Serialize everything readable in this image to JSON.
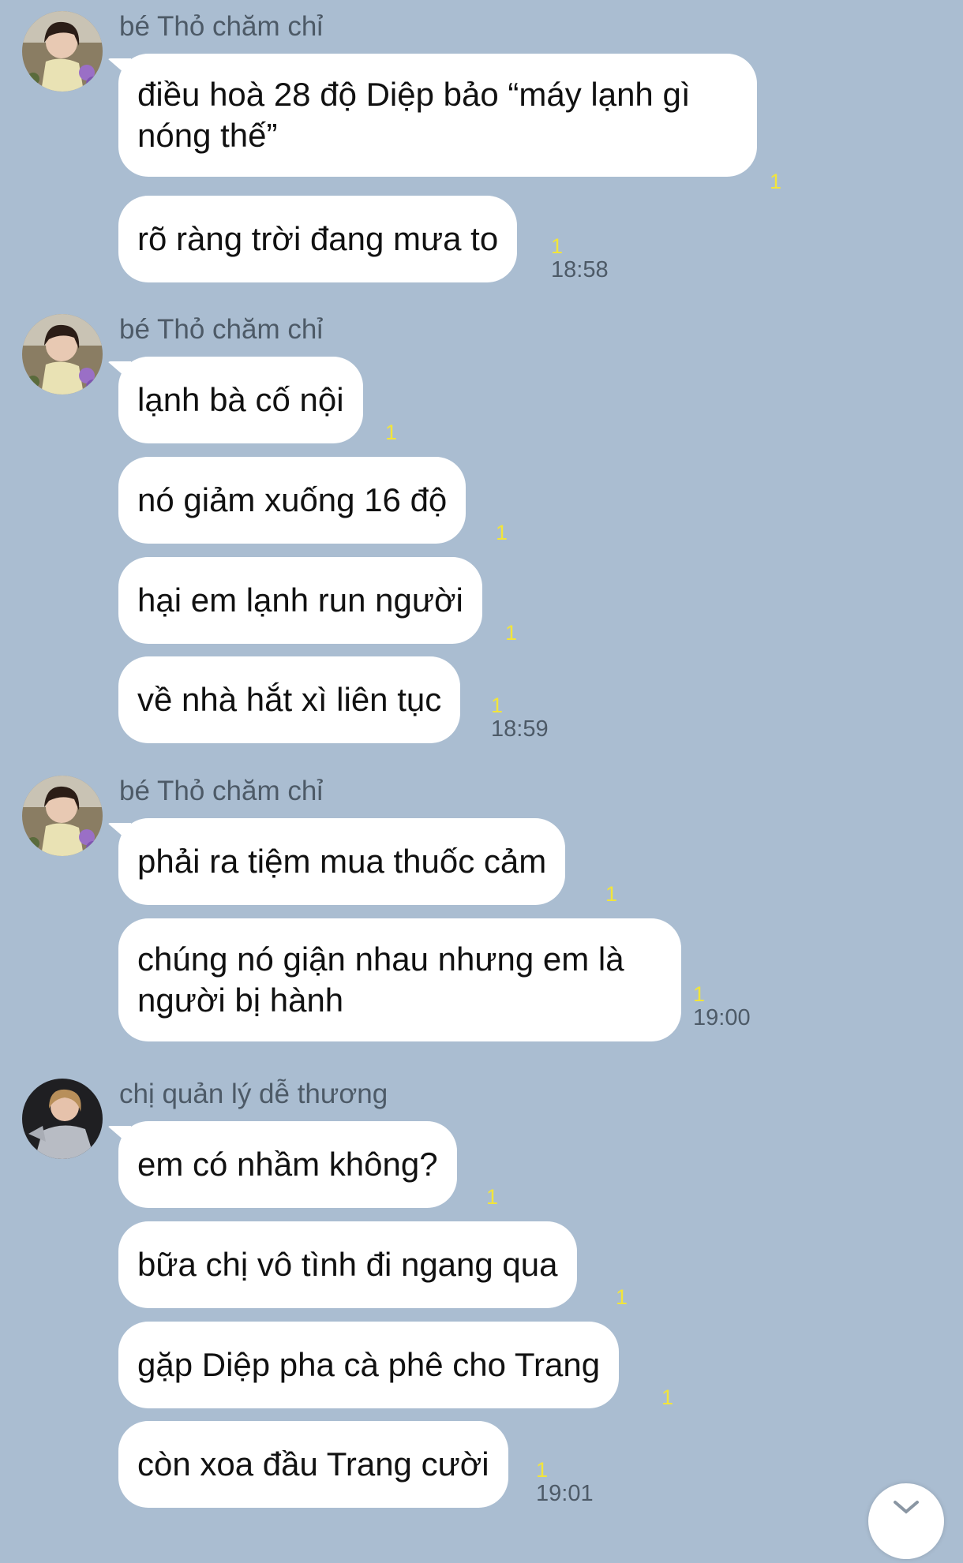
{
  "groups": [
    {
      "sender": "bé Thỏ chăm chỉ",
      "avatar": "avatar-girl-flowers",
      "messages": [
        {
          "text": "điều hoà 28 độ Diệp bảo “máy lạnh gì nóng thế”",
          "unread": "1"
        },
        {
          "text": "rõ ràng trời đang mưa to",
          "unread": "1",
          "time": "18:58"
        }
      ]
    },
    {
      "sender": "bé Thỏ chăm chỉ",
      "avatar": "avatar-girl-flowers",
      "messages": [
        {
          "text": "lạnh bà cố nội",
          "unread": "1"
        },
        {
          "text": "nó giảm xuống 16 độ",
          "unread": "1"
        },
        {
          "text": "hại em lạnh run người",
          "unread": "1"
        },
        {
          "text": "về nhà hắt xì liên tục",
          "unread": "1",
          "time": "18:59"
        }
      ]
    },
    {
      "sender": "bé Thỏ chăm chỉ",
      "avatar": "avatar-girl-flowers",
      "messages": [
        {
          "text": "phải ra tiệm mua thuốc cảm",
          "unread": "1"
        },
        {
          "text": "chúng nó giận nhau nhưng em là người bị hành",
          "unread": "1",
          "time": "19:00"
        }
      ]
    },
    {
      "sender": "chị quản lý dễ thương",
      "avatar": "avatar-woman-dark",
      "messages": [
        {
          "text": "em có nhầm không?",
          "unread": "1"
        },
        {
          "text": "bữa chị vô tình đi ngang qua",
          "unread": "1"
        },
        {
          "text": "gặp Diệp pha cà phê cho Trang",
          "unread": "1"
        },
        {
          "text": "còn xoa đầu Trang cười",
          "unread": "1",
          "time": "19:01"
        }
      ]
    }
  ],
  "colors": {
    "background": "#aabdd1",
    "bubble": "#ffffff",
    "unread": "#f2e53a",
    "meta_text": "#4d5a67"
  },
  "scroll_button": {
    "icon": "chevron-down-icon"
  }
}
